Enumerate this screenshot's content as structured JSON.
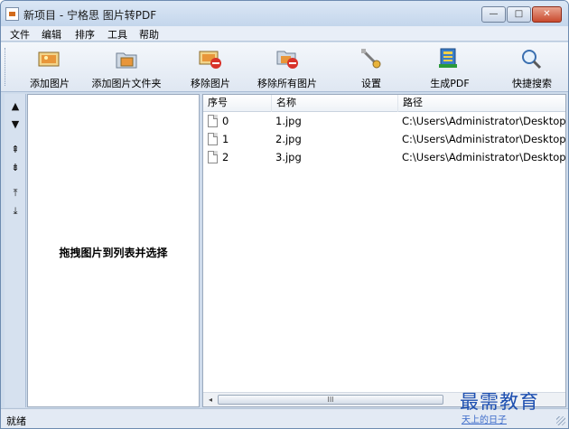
{
  "window": {
    "title": "新项目 - 宁格思 图片转PDF",
    "minimize": "—",
    "maximize": "□",
    "close": "✕"
  },
  "menu": [
    "文件",
    "编辑",
    "排序",
    "工具",
    "帮助"
  ],
  "toolbar": [
    {
      "label": "添加图片",
      "icon": "add-image-icon"
    },
    {
      "label": "添加图片文件夹",
      "icon": "add-folder-icon"
    },
    {
      "label": "移除图片",
      "icon": "remove-image-icon"
    },
    {
      "label": "移除所有图片",
      "icon": "remove-all-icon"
    },
    {
      "label": "设置",
      "icon": "settings-icon"
    },
    {
      "label": "生成PDF",
      "icon": "generate-pdf-icon"
    },
    {
      "label": "快捷搜索",
      "icon": "search-icon"
    }
  ],
  "side_buttons": [
    "▲",
    "▼",
    "⇞",
    "⇟",
    "⤒",
    "⤓"
  ],
  "left_panel": {
    "hint": "拖拽图片到列表并选择"
  },
  "list": {
    "headers": [
      "序号",
      "名称",
      "路径"
    ],
    "rows": [
      {
        "index": "0",
        "name": "1.jpg",
        "path": "C:\\Users\\Administrator\\Desktop"
      },
      {
        "index": "1",
        "name": "2.jpg",
        "path": "C:\\Users\\Administrator\\Desktop"
      },
      {
        "index": "2",
        "name": "3.jpg",
        "path": "C:\\Users\\Administrator\\Desktop"
      }
    ],
    "scroll_left": "◂",
    "scroll_right": "▸",
    "scroll_thumb": "III"
  },
  "status": {
    "text": "就绪"
  },
  "watermark": {
    "main": "最需教育",
    "sub": "天上的日子"
  },
  "colors": {
    "close_button": "#c94a2e",
    "accent": "#1d4fb0"
  }
}
